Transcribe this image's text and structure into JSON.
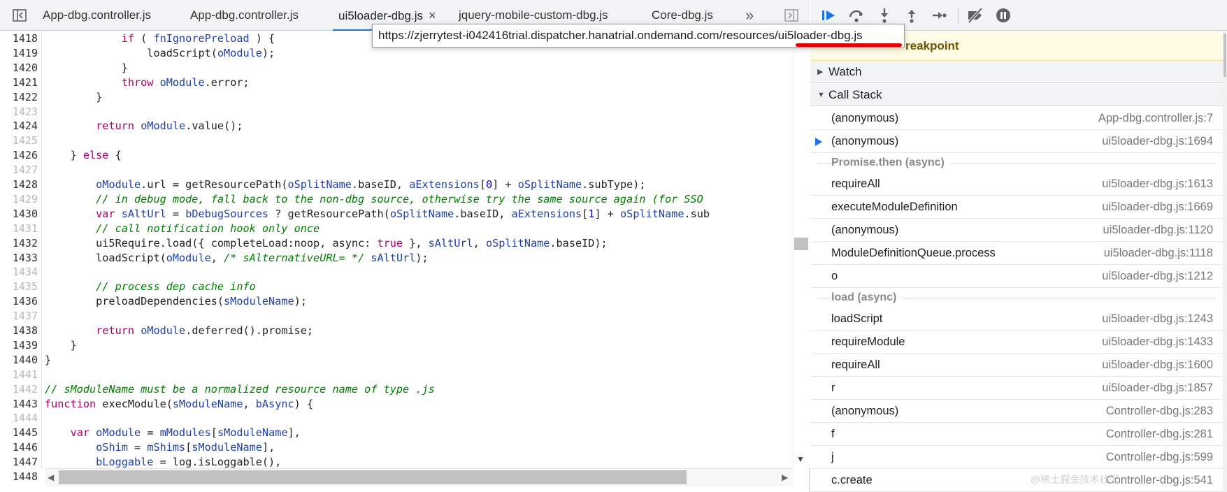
{
  "tabs": [
    {
      "label": "App-dbg.controller.js"
    },
    {
      "label": "App-dbg.controller.js"
    },
    {
      "label": "ui5loader-dbg.js",
      "close": "×"
    },
    {
      "label": "jquery-mobile-custom-dbg.js"
    },
    {
      "label": "Core-dbg.js"
    }
  ],
  "tab_overflow": "»",
  "tooltip": "https://zjerrytest-i042416trial.dispatcher.hanatrial.ondemand.com/resources/ui5loader-dbg.js",
  "line_numbers": [
    "1418",
    "1419",
    "1420",
    "1421",
    "1422",
    "1423",
    "1424",
    "1425",
    "1426",
    "1427",
    "1428",
    "1429",
    "1430",
    "1431",
    "1432",
    "1433",
    "1434",
    "1435",
    "1436",
    "1437",
    "1438",
    "1439",
    "1440",
    "1441",
    "1442",
    "1443",
    "1444",
    "1445",
    "1446",
    "1447",
    "1448"
  ],
  "code": [
    "            if ( fnIgnorePreload ) {",
    "                loadScript(oModule);",
    "            }",
    "            throw oModule.error;",
    "        }",
    "",
    "        return oModule.value();",
    "",
    "    } else {",
    "",
    "        oModule.url = getResourcePath(oSplitName.baseID, aExtensions[0] + oSplitName.subType);",
    "        // in debug mode, fall back to the non-dbg source, otherwise try the same source again (for SSO",
    "        var sAltUrl = bDebugSources ? getResourcePath(oSplitName.baseID, aExtensions[1] + oSplitName.sub",
    "        // call notification hook only once",
    "        ui5Require.load({ completeLoad:noop, async: true }, sAltUrl, oSplitName.baseID);",
    "        loadScript(oModule, /* sAlternativeURL= */ sAltUrl);",
    "",
    "        // process dep cache info",
    "        preloadDependencies(sModuleName);",
    "",
    "        return oModule.deferred().promise;",
    "    }",
    "}",
    "",
    "// sModuleName must be a normalized resource name of type .js",
    "function execModule(sModuleName, bAsync) {",
    "",
    "    var oModule = mModules[sModuleName],",
    "        oShim = mShims[sModuleName],",
    "        bLoggable = log.isLoggable(),"
  ],
  "paused_banner": "reakpoint",
  "sections": {
    "watch": "Watch",
    "call_stack": "Call Stack"
  },
  "call_stack": [
    {
      "fn": "(anonymous)",
      "loc": "App-dbg.controller.js:7"
    },
    {
      "fn": "(anonymous)",
      "loc": "ui5loader-dbg.js:1694",
      "current": true
    },
    {
      "async": "Promise.then (async)"
    },
    {
      "fn": "requireAll",
      "loc": "ui5loader-dbg.js:1613"
    },
    {
      "fn": "executeModuleDefinition",
      "loc": "ui5loader-dbg.js:1669"
    },
    {
      "fn": "(anonymous)",
      "loc": "ui5loader-dbg.js:1120"
    },
    {
      "fn": "ModuleDefinitionQueue.process",
      "loc": "ui5loader-dbg.js:1118"
    },
    {
      "fn": "o",
      "loc": "ui5loader-dbg.js:1212"
    },
    {
      "async": "load (async)"
    },
    {
      "fn": "loadScript",
      "loc": "ui5loader-dbg.js:1243"
    },
    {
      "fn": "requireModule",
      "loc": "ui5loader-dbg.js:1433"
    },
    {
      "fn": "requireAll",
      "loc": "ui5loader-dbg.js:1600"
    },
    {
      "fn": "r",
      "loc": "ui5loader-dbg.js:1857"
    },
    {
      "fn": "(anonymous)",
      "loc": "Controller-dbg.js:283"
    },
    {
      "fn": "f",
      "loc": "Controller-dbg.js:281"
    },
    {
      "fn": "j",
      "loc": "Controller-dbg.js:599"
    },
    {
      "fn": "c.create",
      "loc": "Controller-dbg.js:541"
    }
  ],
  "watermark": "@稀土掘金技术社区",
  "colors": {
    "accent": "#1a73e8",
    "keyword": "#a9006b",
    "variable": "#1e3fa6",
    "comment": "#007f00",
    "annotation": "#e50000"
  }
}
